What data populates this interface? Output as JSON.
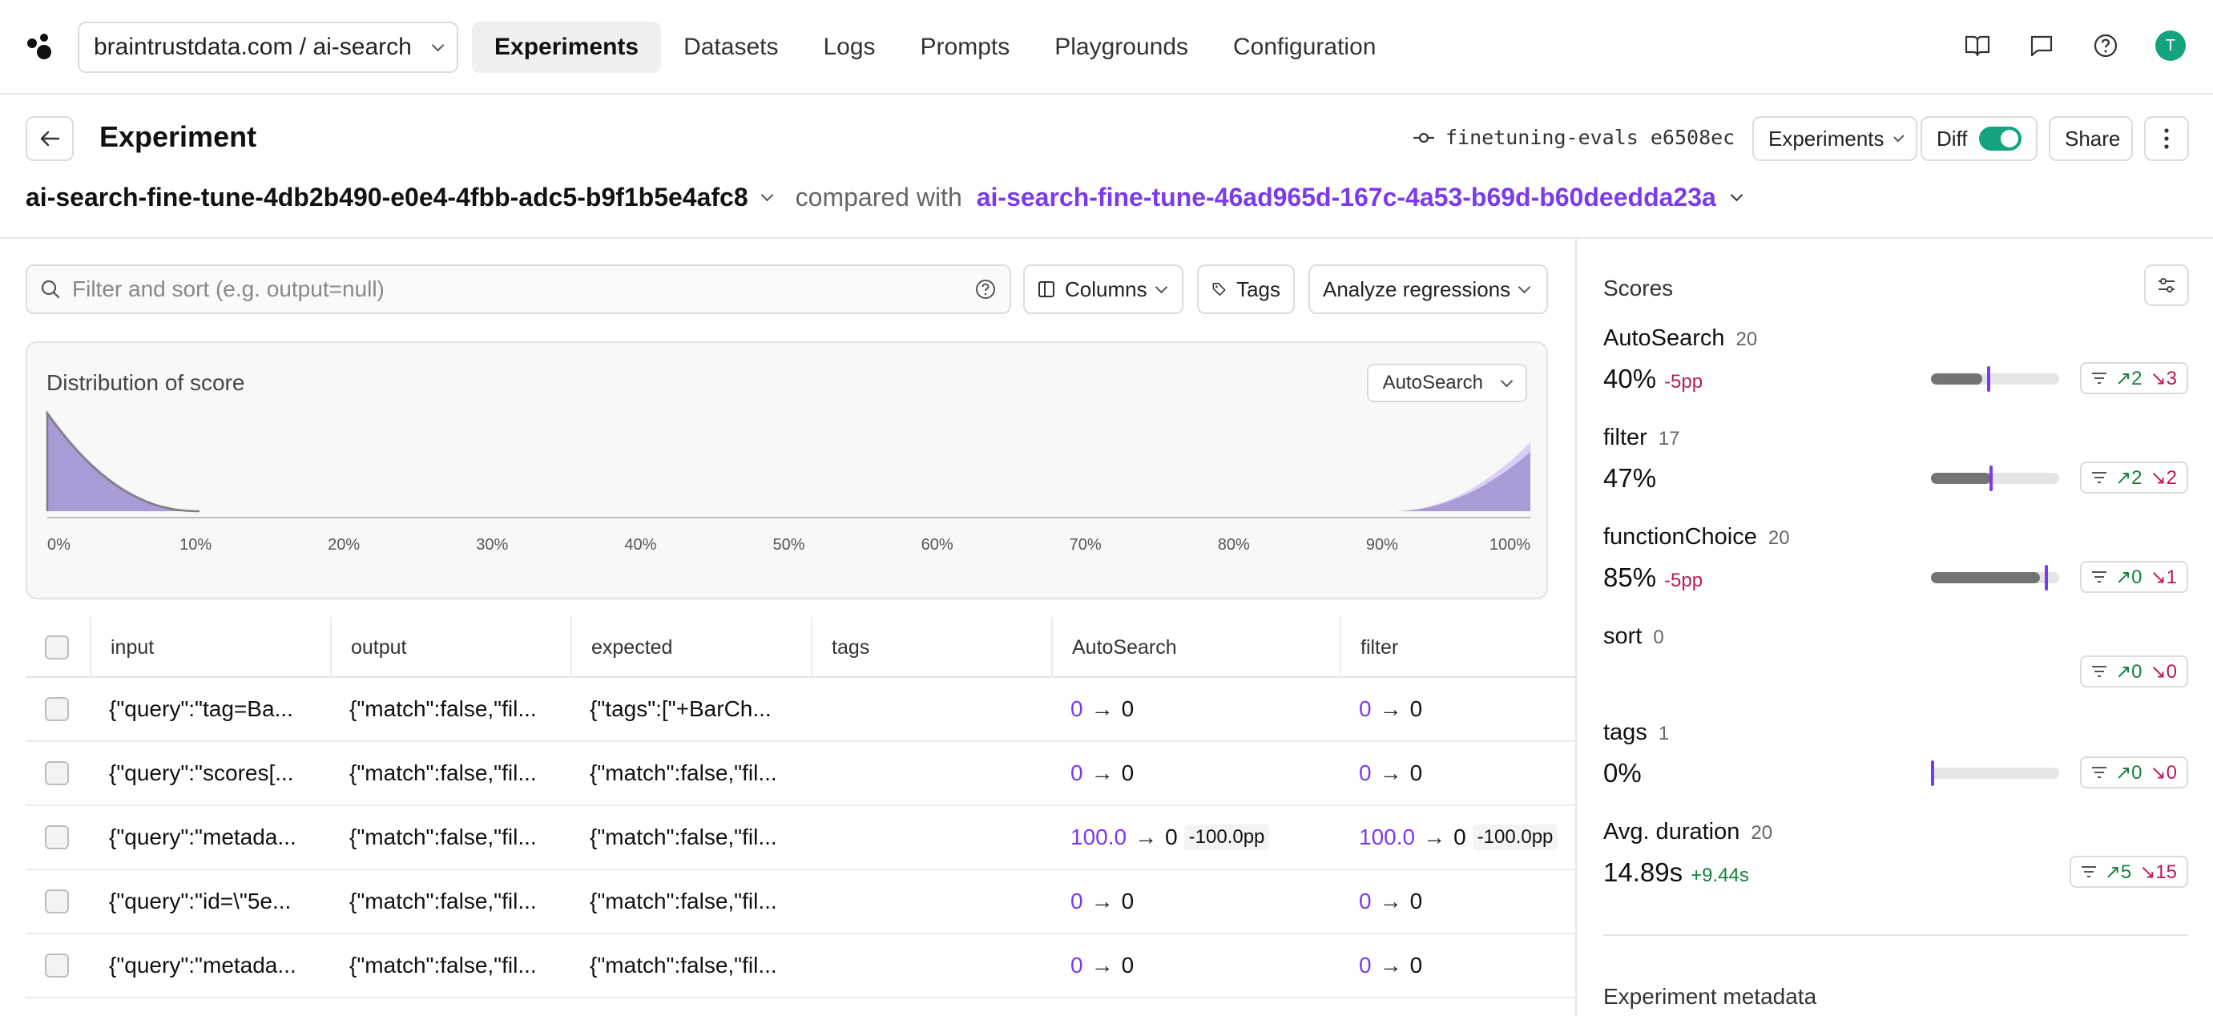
{
  "nav": {
    "org_project": "braintrustdata.com / ai-search",
    "tabs": [
      "Experiments",
      "Datasets",
      "Logs",
      "Prompts",
      "Playgrounds",
      "Configuration"
    ],
    "active_tab": "Experiments",
    "avatar_initial": "T"
  },
  "header": {
    "title": "Experiment",
    "commit_branch": "finetuning-evals e6508ec",
    "experiments_label": "Experiments",
    "diff_label": "Diff",
    "diff_enabled": true,
    "share_label": "Share",
    "base_experiment": "ai-search-fine-tune-4db2b490-e0e4-4fbb-adc5-b9f1b5e4afc8",
    "compared_with_label": "compared with",
    "comparison_experiment": "ai-search-fine-tune-46ad965d-167c-4a53-b69d-b60deedda23a"
  },
  "toolbar": {
    "search_placeholder": "Filter and sort (e.g. output=null)",
    "columns_label": "Columns",
    "tags_label": "Tags",
    "analyze_label": "Analyze regressions"
  },
  "distribution": {
    "title": "Distribution of score",
    "selected_score": "AutoSearch",
    "tick_labels": [
      "0%",
      "10%",
      "20%",
      "30%",
      "40%",
      "50%",
      "60%",
      "70%",
      "80%",
      "90%",
      "100%"
    ],
    "colors": {
      "base": "#a99cd6",
      "comparison": "#d9cef7",
      "outline": "#7e7e7e"
    }
  },
  "table": {
    "columns": [
      "input",
      "output",
      "expected",
      "tags",
      "AutoSearch",
      "filter"
    ],
    "rows": [
      {
        "input": "{\"query\":\"tag=Ba...",
        "output": "{\"match\":false,\"fil...",
        "expected": "{\"tags\":[\"+BarCh...",
        "tags": "",
        "autosearch_old": "0",
        "autosearch_new": "0",
        "autosearch_delta": "",
        "filter_old": "0",
        "filter_new": "0",
        "filter_delta": ""
      },
      {
        "input": "{\"query\":\"scores[...",
        "output": "{\"match\":false,\"fil...",
        "expected": "{\"match\":false,\"fil...",
        "tags": "",
        "autosearch_old": "0",
        "autosearch_new": "0",
        "autosearch_delta": "",
        "filter_old": "0",
        "filter_new": "0",
        "filter_delta": ""
      },
      {
        "input": "{\"query\":\"metada...",
        "output": "{\"match\":false,\"fil...",
        "expected": "{\"match\":false,\"fil...",
        "tags": "",
        "autosearch_old": "100.0",
        "autosearch_new": "0",
        "autosearch_delta": "-100.0pp",
        "filter_old": "100.0",
        "filter_new": "0",
        "filter_delta": "-100.0pp"
      },
      {
        "input": "{\"query\":\"id=\\\"5e...",
        "output": "{\"match\":false,\"fil...",
        "expected": "{\"match\":false,\"fil...",
        "tags": "",
        "autosearch_old": "0",
        "autosearch_new": "0",
        "autosearch_delta": "",
        "filter_old": "0",
        "filter_new": "0",
        "filter_delta": ""
      },
      {
        "input": "{\"query\":\"metada...",
        "output": "{\"match\":false,\"fil...",
        "expected": "{\"match\":false,\"fil...",
        "tags": "",
        "autosearch_old": "0",
        "autosearch_new": "0",
        "autosearch_delta": "",
        "filter_old": "0",
        "filter_new": "0",
        "filter_delta": ""
      }
    ]
  },
  "scores_panel": {
    "title": "Scores",
    "items": [
      {
        "name": "AutoSearch",
        "count": "20",
        "value": "40%",
        "diff": "-5pp",
        "diff_sign": "neg",
        "bar_fraction": 0.4,
        "marker_fraction": 0.45,
        "show_bar": true,
        "improvements": "2",
        "regressions": "3"
      },
      {
        "name": "filter",
        "count": "17",
        "value": "47%",
        "diff": "",
        "diff_sign": "",
        "bar_fraction": 0.47,
        "marker_fraction": 0.47,
        "show_bar": true,
        "improvements": "2",
        "regressions": "2"
      },
      {
        "name": "functionChoice",
        "count": "20",
        "value": "85%",
        "diff": "-5pp",
        "diff_sign": "neg",
        "bar_fraction": 0.85,
        "marker_fraction": 0.9,
        "show_bar": true,
        "improvements": "0",
        "regressions": "1"
      },
      {
        "name": "sort",
        "count": "0",
        "value": "",
        "diff": "",
        "diff_sign": "",
        "bar_fraction": 0,
        "marker_fraction": 0,
        "show_bar": false,
        "improvements": "0",
        "regressions": "0"
      },
      {
        "name": "tags",
        "count": "1",
        "value": "0%",
        "diff": "",
        "diff_sign": "",
        "bar_fraction": 0,
        "marker_fraction": 0,
        "show_bar": true,
        "improvements": "0",
        "regressions": "0"
      },
      {
        "name": "Avg. duration",
        "count": "20",
        "value": "14.89s",
        "diff": "+9.44s",
        "diff_sign": "pos",
        "bar_fraction": 0,
        "marker_fraction": 0,
        "show_bar": false,
        "improvements": "5",
        "regressions": "15"
      }
    ],
    "metadata_title": "Experiment metadata"
  }
}
